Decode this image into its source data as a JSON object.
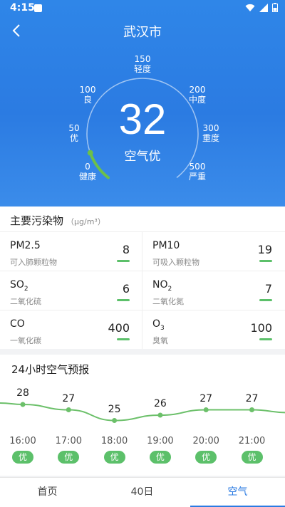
{
  "status": {
    "time": "4:15"
  },
  "header": {
    "city": "武汉市"
  },
  "gauge": {
    "aqi": "32",
    "level": "空气优",
    "labels": [
      {
        "num": "0",
        "txt": "健康"
      },
      {
        "num": "50",
        "txt": "优"
      },
      {
        "num": "100",
        "txt": "良"
      },
      {
        "num": "150",
        "txt": "轻度"
      },
      {
        "num": "200",
        "txt": "中度"
      },
      {
        "num": "300",
        "txt": "重度"
      },
      {
        "num": "500",
        "txt": "严重"
      }
    ],
    "color": "#6cc04a"
  },
  "pollutants": {
    "title": "主要污染物",
    "unit": "（μg/m³）",
    "items": [
      {
        "name": "PM2.5",
        "sub": "",
        "desc": "可入肺颗粒物",
        "value": "8"
      },
      {
        "name": "PM10",
        "sub": "",
        "desc": "可吸入颗粒物",
        "value": "19"
      },
      {
        "name": "SO",
        "sub": "2",
        "desc": "二氧化硫",
        "value": "6"
      },
      {
        "name": "NO",
        "sub": "2",
        "desc": "二氧化氮",
        "value": "7"
      },
      {
        "name": "CO",
        "sub": "",
        "desc": "一氧化碳",
        "value": "400"
      },
      {
        "name": "O",
        "sub": "3",
        "desc": "臭氧",
        "value": "100"
      }
    ],
    "good_color": "#5cc06a"
  },
  "forecast": {
    "title": "24小时空气预报",
    "points": [
      {
        "time": "16:00",
        "value": "28",
        "level": "优"
      },
      {
        "time": "17:00",
        "value": "27",
        "level": "优"
      },
      {
        "time": "18:00",
        "value": "25",
        "level": "优"
      },
      {
        "time": "19:00",
        "value": "26",
        "level": "优"
      },
      {
        "time": "20:00",
        "value": "27",
        "level": "优"
      },
      {
        "time": "21:00",
        "value": "27",
        "level": "优"
      }
    ]
  },
  "nav": {
    "tabs": [
      "首页",
      "40日",
      "空气"
    ],
    "active": "空气"
  }
}
